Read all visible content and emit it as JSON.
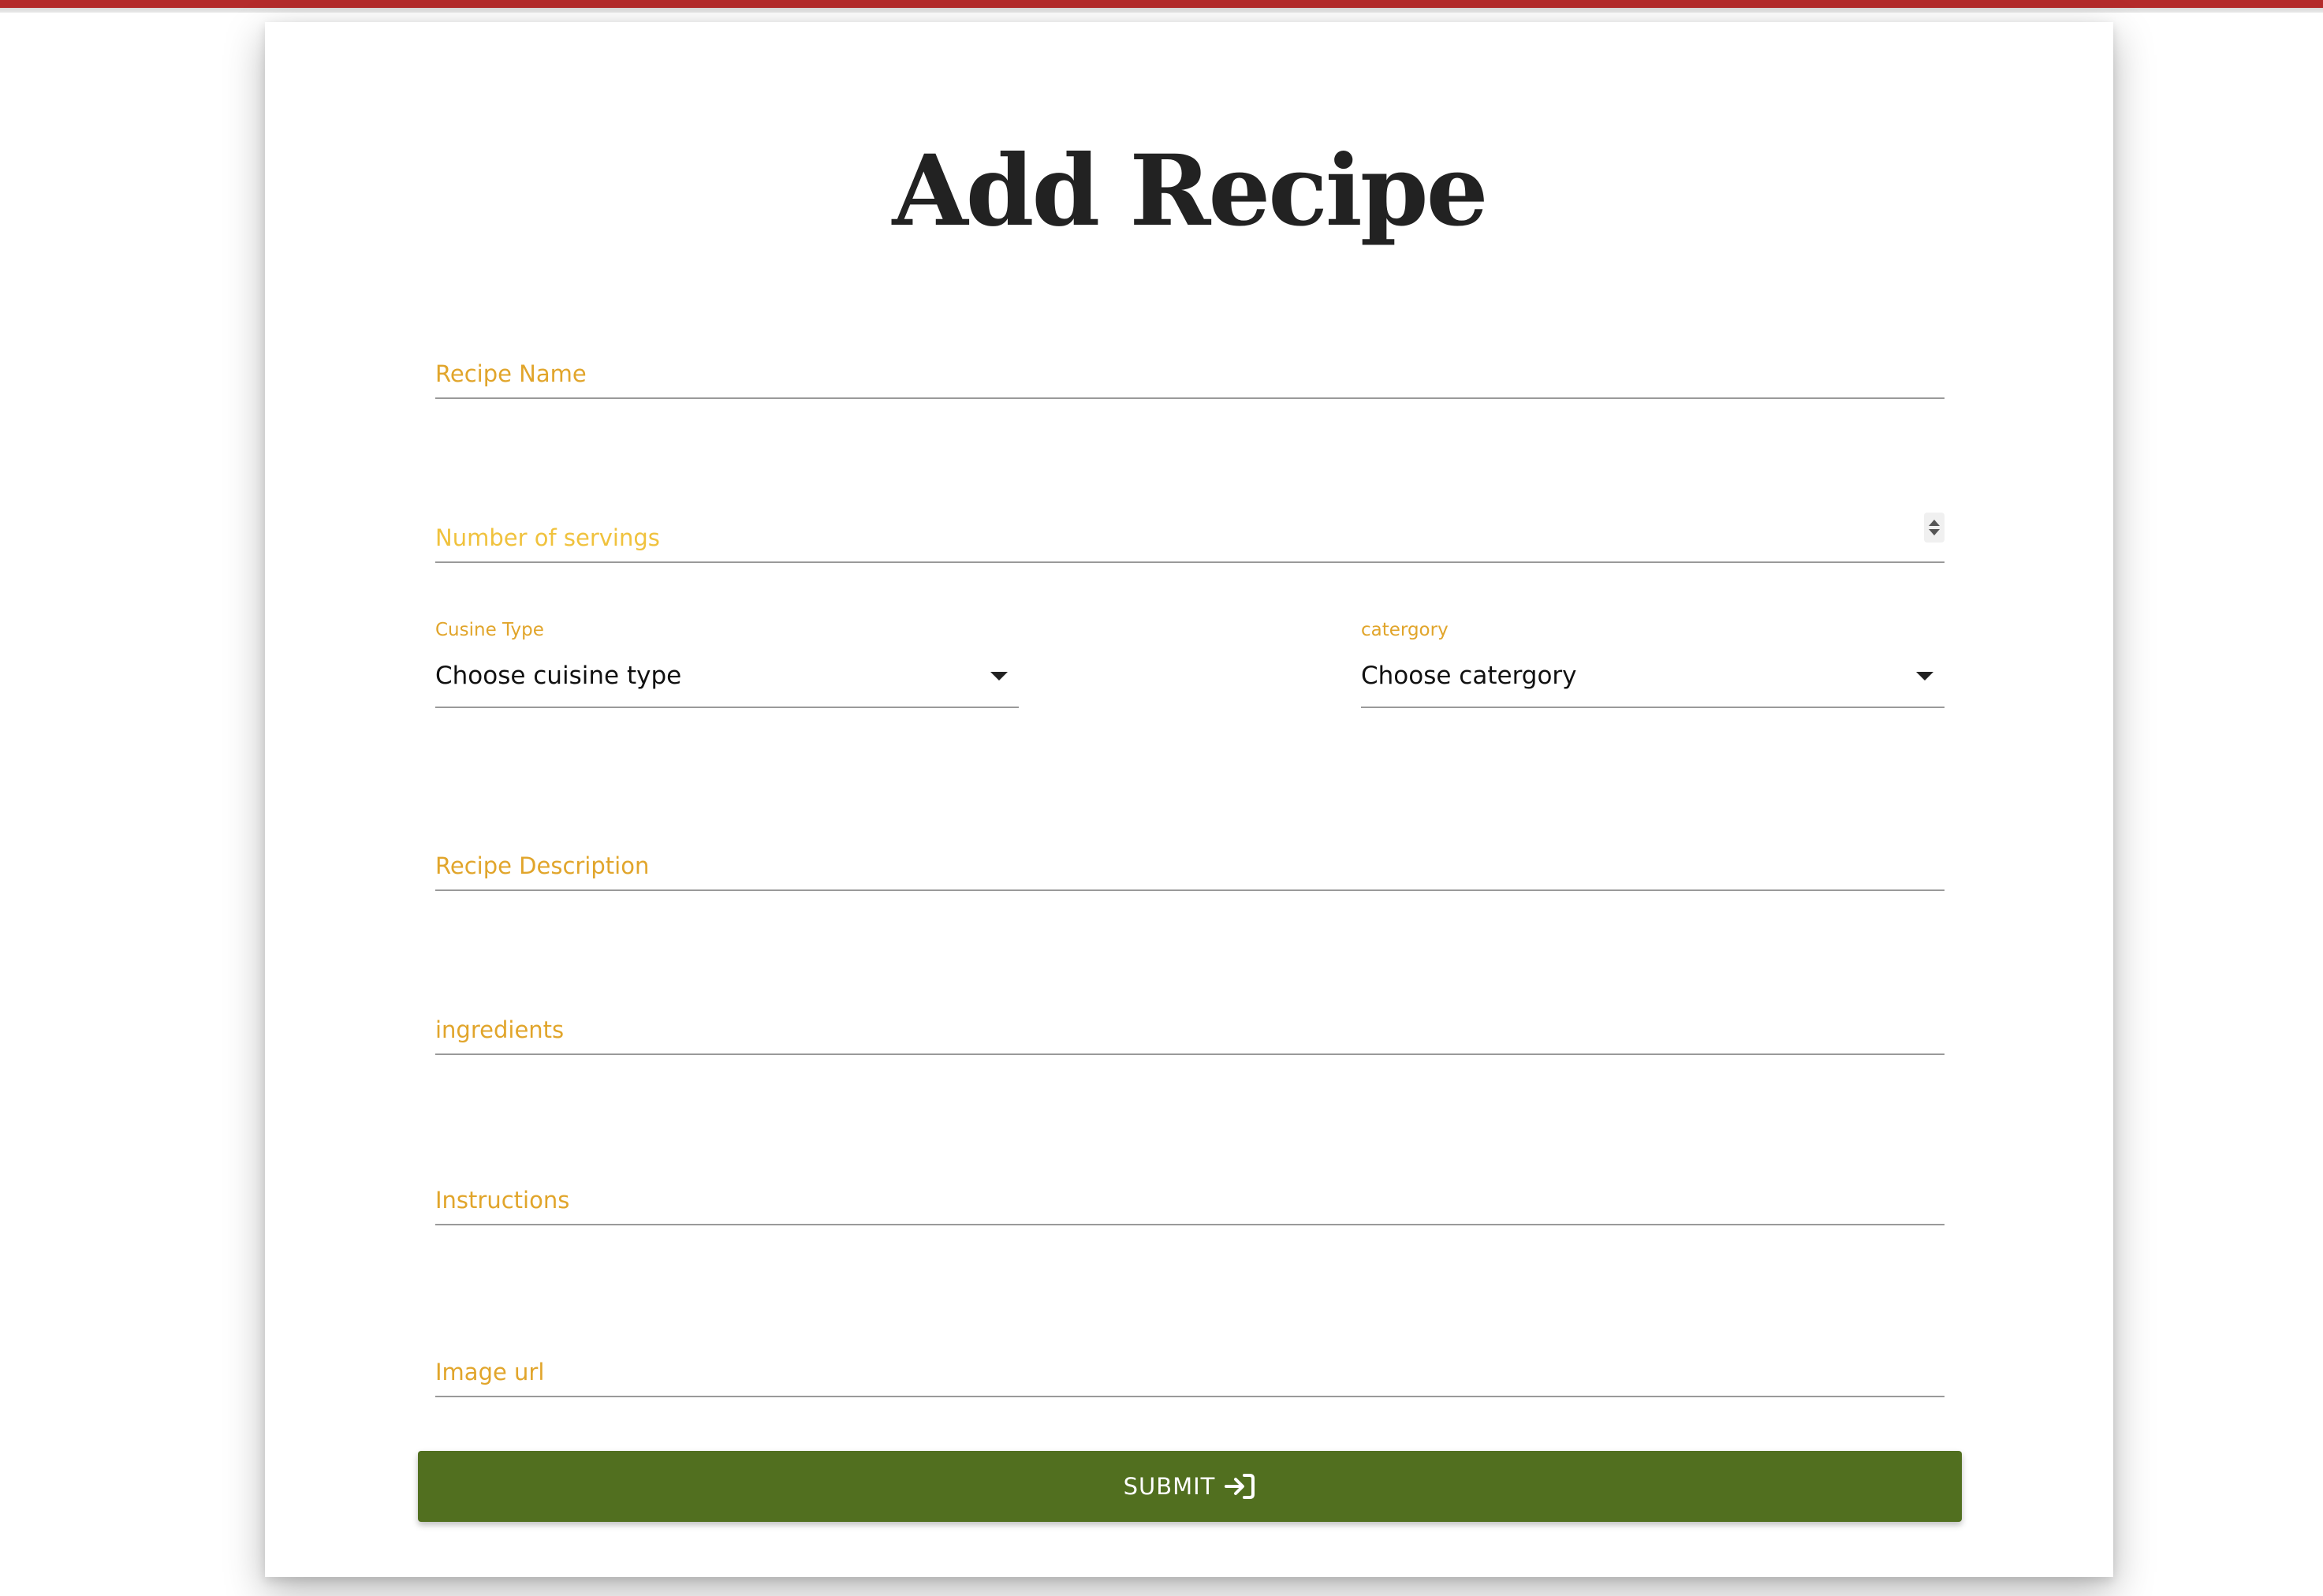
{
  "header": {
    "accent_color": "#b42b2b"
  },
  "form": {
    "title": "Add Recipe",
    "fields": {
      "recipe_name": {
        "placeholder": "Recipe Name",
        "value": ""
      },
      "servings": {
        "placeholder": "Number of servings",
        "value": ""
      },
      "description": {
        "placeholder": "Recipe Description",
        "value": ""
      },
      "ingredients": {
        "placeholder": "ingredients",
        "value": ""
      },
      "instructions": {
        "placeholder": "Instructions",
        "value": ""
      },
      "image_url": {
        "placeholder": "Image url",
        "value": ""
      }
    },
    "selects": {
      "cuisine": {
        "label": "Cusine Type",
        "value": "Choose cuisine type"
      },
      "category": {
        "label": "catergory",
        "value": "Choose catergory"
      }
    },
    "submit": {
      "label": "SUBMIT",
      "icon": "login-arrow-icon",
      "color": "#516f1f"
    },
    "label_color": "#e1a52b"
  }
}
